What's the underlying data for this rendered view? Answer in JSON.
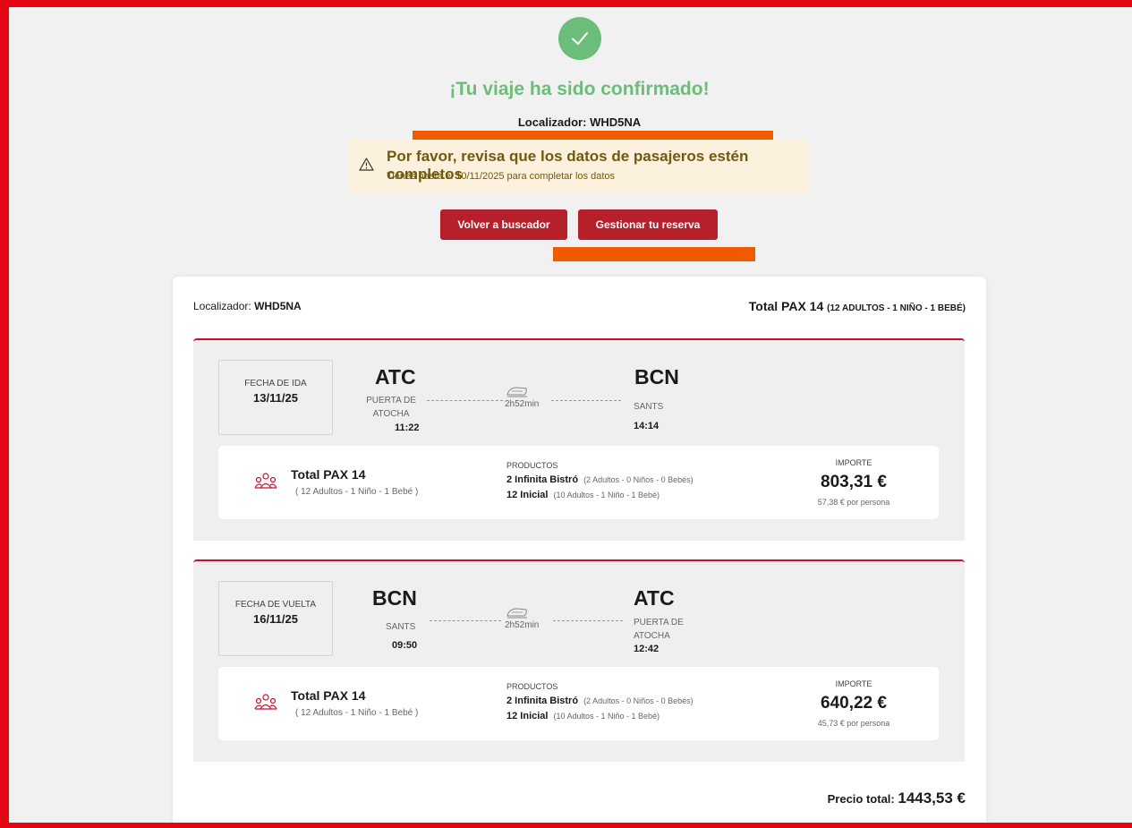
{
  "header": {
    "title": "¡Tu viaje ha sido confirmado!",
    "locator_label": "Localizador:",
    "locator_code": "WHD5NA"
  },
  "warning": {
    "title": "Por favor, revisa que los datos de pasajeros estén completos",
    "subtitle": "Tienes hasta el 10/11/2025 para completar los datos"
  },
  "buttons": {
    "back_label": "Volver a buscador",
    "manage_label": "Gestionar tu reserva"
  },
  "summary": {
    "locator_label": "Localizador:",
    "locator_code": "WHD5NA",
    "total_pax": "Total PAX 14",
    "total_pax_detail": "(12 ADULTOS - 1 NIÑO - 1 BEBÉ)"
  },
  "trips": [
    {
      "date_label": "FECHA DE IDA",
      "date": "13/11/25",
      "origin_code": "ATC",
      "origin_name_1": "PUERTA DE",
      "origin_name_2": "ATOCHA",
      "origin_time": "11:22",
      "duration": "2h52min",
      "dest_code": "BCN",
      "dest_name_1": "SANTS",
      "dest_name_2": "",
      "dest_time": "14:14",
      "pax_title": "Total PAX 14",
      "pax_sub": "( 12 Adultos - 1 Niño - 1 Bebé )",
      "products_label": "PRODUCTOS",
      "products": [
        {
          "name": "2 Infinita Bistró",
          "detail": "(2 Adultos - 0 Niños - 0 Bebés)"
        },
        {
          "name": "12 Inicial",
          "detail": "(10 Adultos - 1 Niño - 1 Bebé)"
        }
      ],
      "amount_label": "IMPORTE",
      "amount": "803,31 €",
      "per_person": "57,38 € por persona"
    },
    {
      "date_label": "FECHA DE VUELTA",
      "date": "16/11/25",
      "origin_code": "BCN",
      "origin_name_1": "SANTS",
      "origin_name_2": "",
      "origin_time": "09:50",
      "duration": "2h52min",
      "dest_code": "ATC",
      "dest_name_1": "PUERTA DE",
      "dest_name_2": "ATOCHA",
      "dest_time": "12:42",
      "pax_title": "Total PAX 14",
      "pax_sub": "( 12 Adultos - 1 Niño - 1 Bebé )",
      "products_label": "PRODUCTOS",
      "products": [
        {
          "name": "2 Infinita Bistró",
          "detail": "(2 Adultos - 0 Niños - 0 Bebés)"
        },
        {
          "name": "12 Inicial",
          "detail": "(10 Adultos - 1 Niño - 1 Bebé)"
        }
      ],
      "amount_label": "IMPORTE",
      "amount": "640,22 €",
      "per_person": "45,73 € por persona"
    }
  ],
  "total": {
    "label": "Precio total:",
    "value": "1443,53 €"
  },
  "colors": {
    "frame": "#e30613",
    "success": "#6dbd7a",
    "button": "#b5202a",
    "warning_bg": "#fbf1dc",
    "highlight": "#f05a00"
  },
  "icons": [
    "check-icon",
    "warning-icon",
    "train-icon",
    "passengers-icon"
  ]
}
